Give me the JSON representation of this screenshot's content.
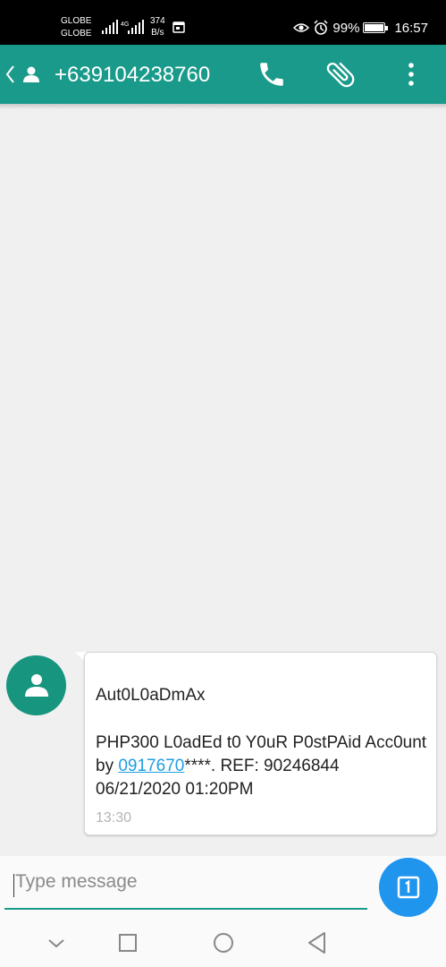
{
  "status_bar": {
    "carrier_1": "GLOBE",
    "carrier_2": "GLOBE",
    "network": "4G",
    "speed_value": "374",
    "speed_unit": "B/s",
    "battery": "99%",
    "time": "16:57"
  },
  "toolbar": {
    "contact_number": "+639104238760",
    "icons": [
      "back-icon",
      "person-icon",
      "phone-icon",
      "paperclip-icon",
      "more-vert-icon"
    ]
  },
  "conversation": {
    "messages": [
      {
        "sender_line": "Aut0L0aDmAx",
        "body_before_link": "PHP300  L0adEd t0 Y0uR P0stPAid Acc0unt by ",
        "link_text": "0917670",
        "body_after_link": "****. REF: 90246844 06/21/2020 01:20PM",
        "time": "13:30"
      }
    ]
  },
  "composer": {
    "placeholder": "Type message",
    "value": ""
  },
  "colors": {
    "toolbar": "#1a9a8a",
    "avatar": "#17957f",
    "send_button": "#1f95ee",
    "link": "#1e9ee4"
  }
}
